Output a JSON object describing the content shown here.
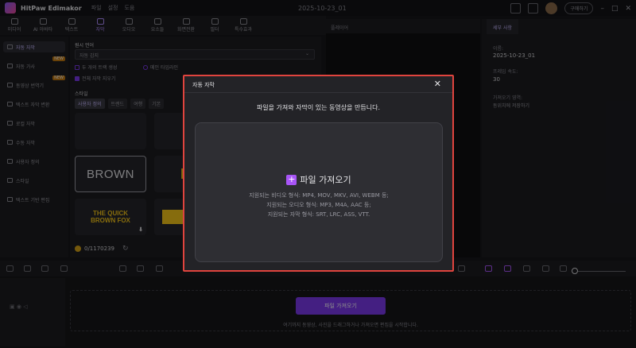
{
  "app": {
    "name": "HitPaw Edimakor",
    "menu": [
      "파일",
      "설정",
      "도움"
    ],
    "project_date": "2025-10-23_01",
    "upgrade_label": "구매하기"
  },
  "toolbar": {
    "tools": [
      {
        "label": "미디어",
        "icon": "media-icon"
      },
      {
        "label": "AI 아바타",
        "icon": "avatar-icon"
      },
      {
        "label": "텍스트",
        "icon": "text-icon"
      },
      {
        "label": "자막",
        "icon": "subtitle-icon"
      },
      {
        "label": "오디오",
        "icon": "audio-icon"
      },
      {
        "label": "요소들",
        "icon": "elements-icon"
      },
      {
        "label": "화면전환",
        "icon": "transition-icon"
      },
      {
        "label": "필터",
        "icon": "filter-icon"
      },
      {
        "label": "특수효과",
        "icon": "effects-icon"
      }
    ],
    "active_index": 3
  },
  "sidebar": {
    "items": [
      {
        "label": "자동 자막",
        "active": true,
        "new": false
      },
      {
        "label": "자동 가사",
        "active": false,
        "new": true
      },
      {
        "label": "동영상 번역기",
        "active": false,
        "new": true
      },
      {
        "label": "텍스트 자막 변환",
        "active": false,
        "new": false
      },
      {
        "label": "로컬 자막",
        "active": false,
        "new": false
      },
      {
        "label": "수동 자막",
        "active": false,
        "new": false
      },
      {
        "label": "사용자 정의",
        "active": false,
        "new": false
      },
      {
        "label": "스타일",
        "active": false,
        "new": false
      },
      {
        "label": "텍스트 기반 편집",
        "active": false,
        "new": false
      }
    ],
    "new_badge": "NEW"
  },
  "panel": {
    "source_lang_label": "원시 언어",
    "source_lang_value": "자동 감지",
    "option_two_speakers": "두 개의 트랙 생성",
    "option_main_timeline": "메인 타임라인",
    "option_delete_all": "전체 자막 지우기",
    "style_label": "스타일",
    "style_tabs": [
      "사용자 정의",
      "트렌드",
      "여행",
      "기본"
    ],
    "tile_brown": "BROWN",
    "tile_fox": "THE QUICK BROWN FOX",
    "credits": "0/1170239"
  },
  "player": {
    "title": "플레이어"
  },
  "details": {
    "tab": "세부 사항",
    "name_label": "이름:",
    "name_value": "2025-10-23_01",
    "fps_label": "프레임 속도:",
    "fps_value": "30",
    "save_label": "가져오기 영역:",
    "save_value": "동위치에 저장하기"
  },
  "timeline": {
    "import_button": "파일 가져오기",
    "drop_hint": "여기까지 동영상, 사진을 드래그하거나 가져오면 편집을 시작합니다."
  },
  "dialog": {
    "title": "자동 자막",
    "message": "파일을 가져와 자막이 있는 동영상을 만듭니다.",
    "import_label": "파일 가져오기",
    "formats": [
      "지원되는 비디오 형식: MP4, MOV, MKV, AVI, WEBM 등;",
      "지원되는 오디오 형식: MP3, M4A, AAC 등;",
      "지원되는 자막 형식: SRT, LRC, ASS, VTT."
    ]
  },
  "colors": {
    "accent": "#7c3aed",
    "highlight": "#e0443e",
    "gold": "#f5c518"
  }
}
